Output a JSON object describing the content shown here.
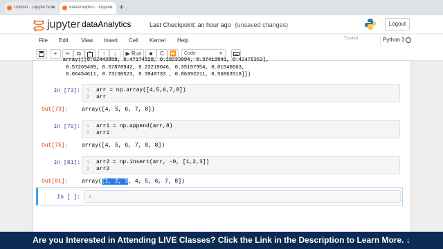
{
  "browser": {
    "tab1_title": "Untitled - Jupyter Notebook",
    "tab2_title": "dataAnalytics - Jupyter Notebook",
    "tab_close": "×",
    "new_tab": "+"
  },
  "header": {
    "app_name": "jupyter",
    "notebook_name": "dataAnalytics",
    "checkpoint": "Last Checkpoint: an hour ago",
    "unsaved": "(unsaved changes)",
    "logout_label": "Logout"
  },
  "menu": {
    "items": [
      "File",
      "Edit",
      "View",
      "Insert",
      "Cell",
      "Kernel",
      "Help"
    ],
    "trusted": "Trusted",
    "kernel": "Python 3"
  },
  "toolbar": {
    "save_icon": "floppy-icon",
    "add_label": "+",
    "cut_label": "✂",
    "copy_label": "⧉",
    "paste_label": "📋",
    "up_label": "↑",
    "down_label": "↓",
    "run_label": "▶ Run",
    "stop_label": "■",
    "restart_label": "C",
    "restart_run_label": "⏩",
    "cell_type": "Code",
    "cell_type_caret": "▼",
    "keyboard_icon": "keyboard-icon"
  },
  "cells": {
    "prev_output": "       array([[0.82443858, 0.47174528, 0.18233094, 0.37412841, 0.42478353],\n        0.57269489, 0.67878942, 0.23219046, 0.35197954, 0.01540663,\n        0.06454611, 0.73190523, 0.3948733 , 0.06392211, 0.56863518]])",
    "c73": {
      "prompt_in": "In [73]:",
      "lines": [
        "arr = np.array([4,5,6,7,8])",
        "arr"
      ],
      "prompt_out": "Out[73]:",
      "output": "array([4, 5, 6, 7, 8])"
    },
    "c75": {
      "prompt_in": "In [75]:",
      "lines": [
        "arr1 = np.append(arr,8)",
        "arr1"
      ],
      "prompt_out": "Out[75]:",
      "output": "array([4, 5, 6, 7, 8, 8])"
    },
    "c81": {
      "prompt_in": "In [81]:",
      "lines": [
        "arr2 = np.insert(arr, -0, [1,2,3])",
        "arr2"
      ],
      "prompt_out": "Out[81]:",
      "output_pre": "array(",
      "output_sel": "[1, 2, 3",
      "output_post": ", 4, 5, 6, 7, 8])"
    },
    "empty": {
      "prompt_in": "In [ ]:",
      "line_no": "1"
    },
    "line_numbers": [
      "1",
      "2"
    ]
  },
  "banner": {
    "text": "Are you Interested in Attending LIVE Classes? Click the Link in the Description to Learn More. ↓"
  },
  "colors": {
    "banner_bg": "#0b2b54",
    "prompt_in": "#303f9f",
    "prompt_out": "#d84315",
    "selection": "#2a7ae2",
    "jupyter_orange": "#f37626"
  }
}
